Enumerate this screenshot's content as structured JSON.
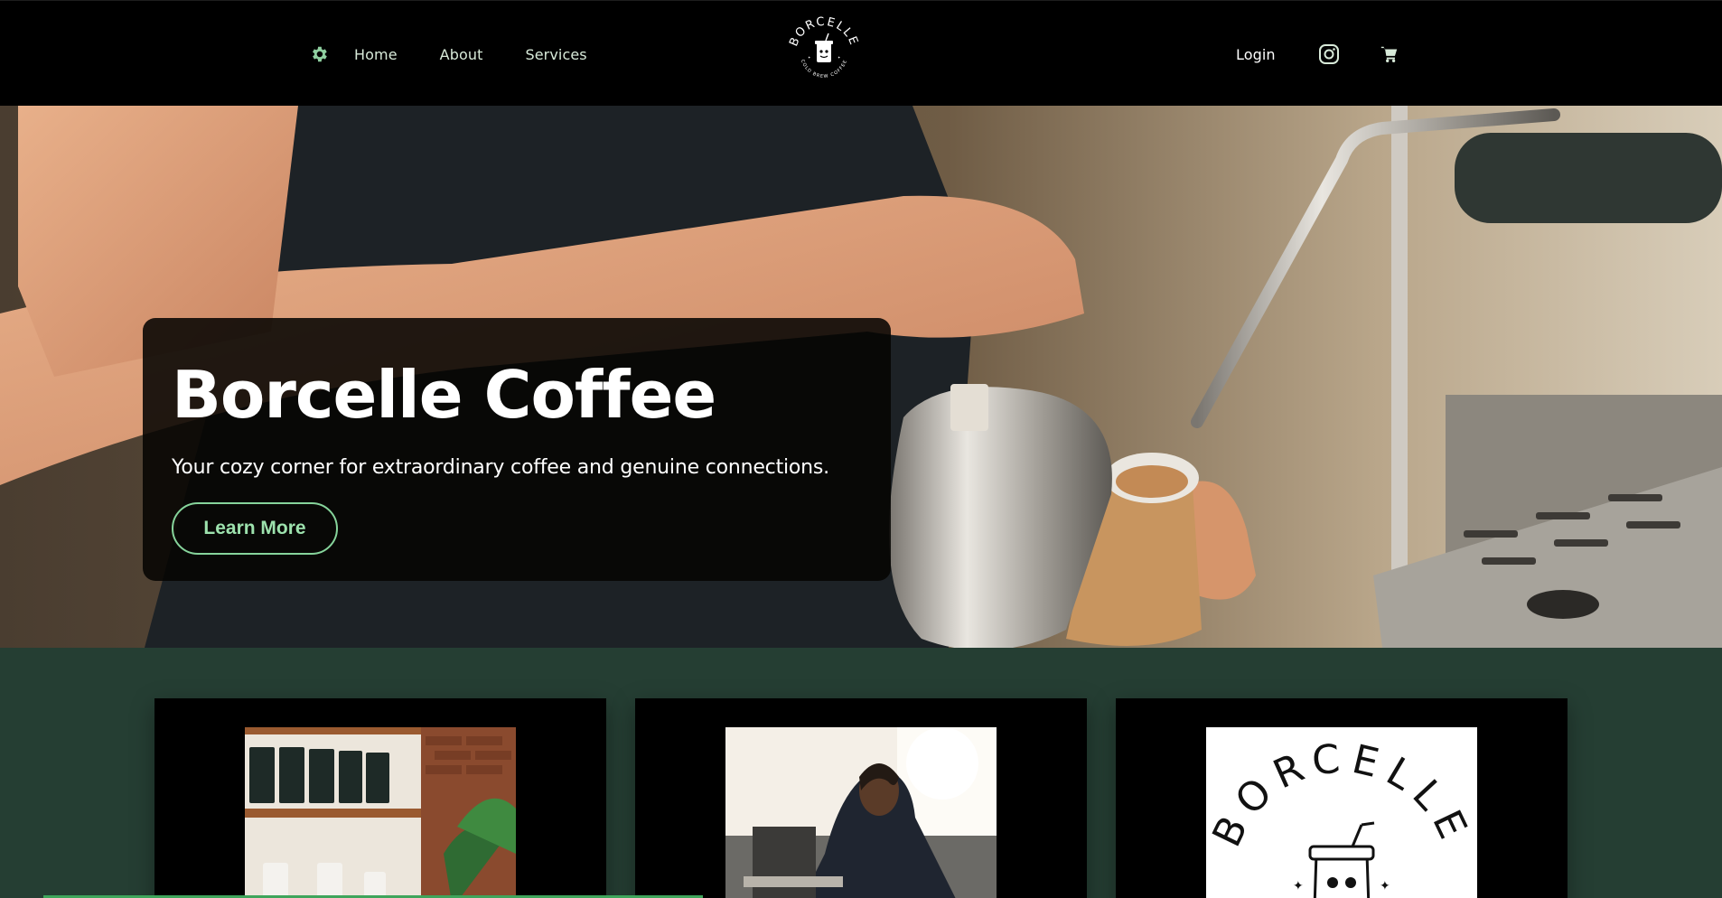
{
  "nav": {
    "settings_icon": "gear-icon",
    "links": [
      "Home",
      "About",
      "Services"
    ],
    "login": "Login",
    "instagram_icon": "instagram-icon",
    "cart_icon": "cart-icon",
    "logo": {
      "brand": "BORCELLE",
      "tagline": "COLD BREW COFFEE"
    }
  },
  "hero": {
    "title": "Borcelle Coffee",
    "subtitle": "Your cozy corner for extraordinary coffee and genuine connections.",
    "cta": "Learn More"
  },
  "cards": [
    {
      "image": "coffee-shelf-photo"
    },
    {
      "image": "barista-photo"
    },
    {
      "image": "borcelle-logo-image",
      "brand": "BORCELLE"
    }
  ],
  "colors": {
    "nav_bg": "#000000",
    "section_bg": "#253e33",
    "accent": "#86d49b",
    "nav_text": "#d8ead9"
  }
}
